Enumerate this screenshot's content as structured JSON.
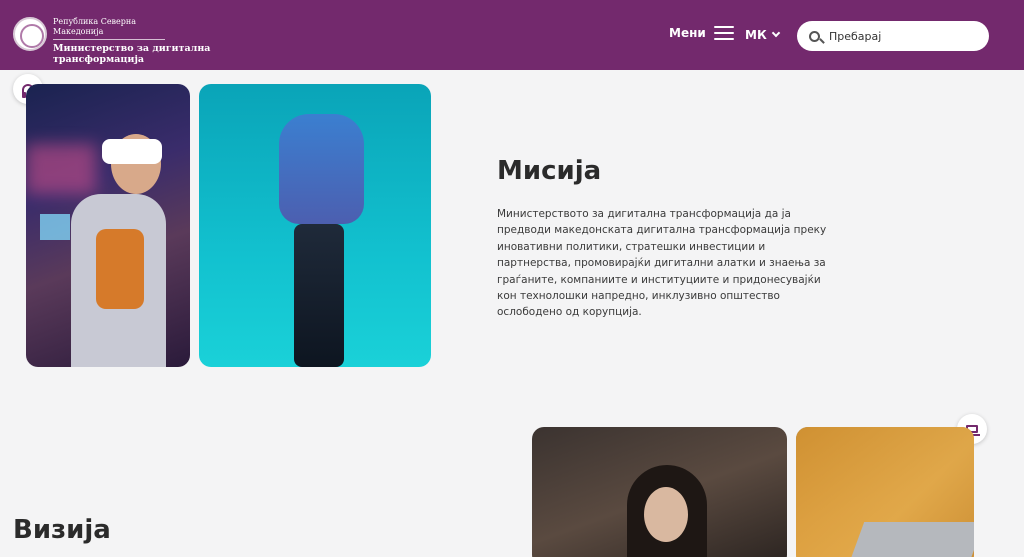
{
  "header": {
    "logo_small": "Република Северна Македонија",
    "logo_big_line1": "Министерство за дигитална",
    "logo_big_line2": "трансформација",
    "menu_label": "Мени",
    "lang_label": "МК",
    "search_placeholder": "Пребарај"
  },
  "mission": {
    "title": "Мисија",
    "text": "Министерството за дигитална трансформација да ја предводи македонската дигитална трансформација преку иновативни политики, стратешки инвестиции и партнерства, промовирајќи дигитални алатки и знаења за граѓаните, компаниите и институциите и придонесувајќи кон технолошки напредно, инклузивно општество ослободено од корупција."
  },
  "vision": {
    "title": "Визија"
  },
  "colors": {
    "brand": "#73296d",
    "background": "#f4f4f5"
  },
  "icons": {
    "accessibility": "headset-icon",
    "device": "laptop-icon",
    "search": "search-icon",
    "menu": "hamburger-icon",
    "lang": "chevron-down-icon"
  }
}
